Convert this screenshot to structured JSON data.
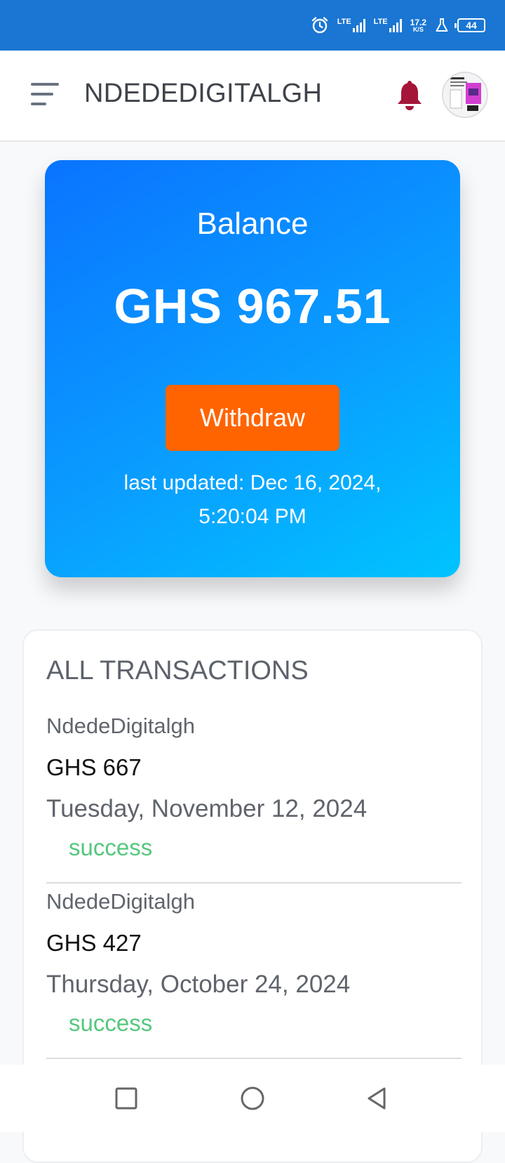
{
  "status_bar": {
    "lte1": "LTE",
    "lte2": "LTE",
    "speed_value": "17.2",
    "speed_unit": "K/S",
    "battery": "44"
  },
  "header": {
    "brand": "NDEDEDIGITALGH"
  },
  "balance": {
    "label": "Balance",
    "amount": "GHS 967.51",
    "withdraw_label": "Withdraw",
    "last_updated": "last updated: Dec 16, 2024, 5:20:04 PM"
  },
  "transactions": {
    "title": "ALL TRANSACTIONS",
    "items": [
      {
        "name": "NdedeDigitalgh",
        "amount": "GHS 667",
        "date": "Tuesday, November 12, 2024",
        "status": "success"
      },
      {
        "name": "NdedeDigitalgh",
        "amount": "GHS 427",
        "date": "Thursday, October 24, 2024",
        "status": "success"
      }
    ]
  },
  "colors": {
    "status_bar": "#1a76d2",
    "card_gradient_start": "#0a74ff",
    "card_gradient_end": "#00c4ff",
    "withdraw_button": "#ff6400",
    "bell": "#a5153a",
    "success": "#55c77d"
  },
  "icons": {
    "menu": "hamburger-menu-icon",
    "bell": "bell-icon",
    "alarm": "alarm-clock-icon",
    "beaker": "flask-icon",
    "nav_recent": "square-icon",
    "nav_home": "circle-icon",
    "nav_back": "triangle-back-icon"
  }
}
